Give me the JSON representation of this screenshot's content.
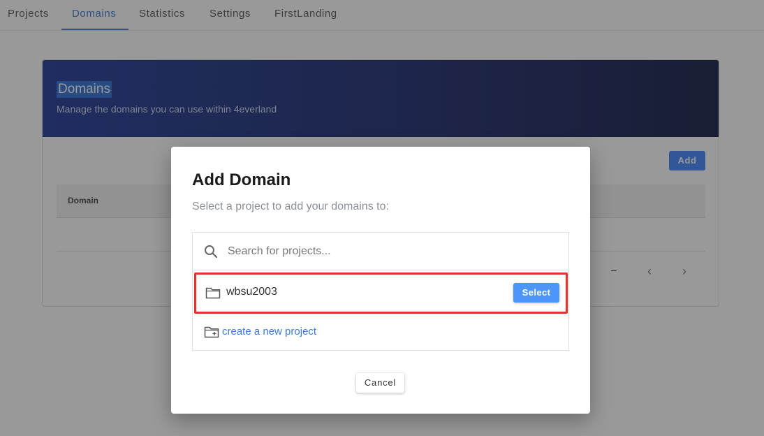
{
  "nav": {
    "tabs": [
      {
        "label": "Projects"
      },
      {
        "label": "Domains"
      },
      {
        "label": "Statistics"
      },
      {
        "label": "Settings"
      },
      {
        "label": "FirstLanding"
      }
    ],
    "active_tab": "Domains"
  },
  "page": {
    "banner_title": "Domains",
    "banner_subtitle": "Manage the domains you can use within 4everland",
    "add_label": "Add",
    "table_header_domain": "Domain",
    "pager_dash": "–",
    "pager_prev": "‹",
    "pager_next": "›"
  },
  "dialog": {
    "title": "Add Domain",
    "subtitle": "Select a project to add your domains to:",
    "search_placeholder": "Search for projects...",
    "projects": [
      {
        "name": "wbsu2003",
        "action_label": "Select"
      }
    ],
    "create_label": "create a new project",
    "cancel_label": "Cancel"
  },
  "icons": {
    "search": "search-icon",
    "folder": "folder-icon",
    "folder_plus": "folder-plus-icon"
  },
  "colors": {
    "accent": "#3b7bd9",
    "highlight_border": "#e5322d",
    "banner_start": "#203897",
    "banner_end": "#151b47",
    "select_button": "#4e95fb"
  }
}
